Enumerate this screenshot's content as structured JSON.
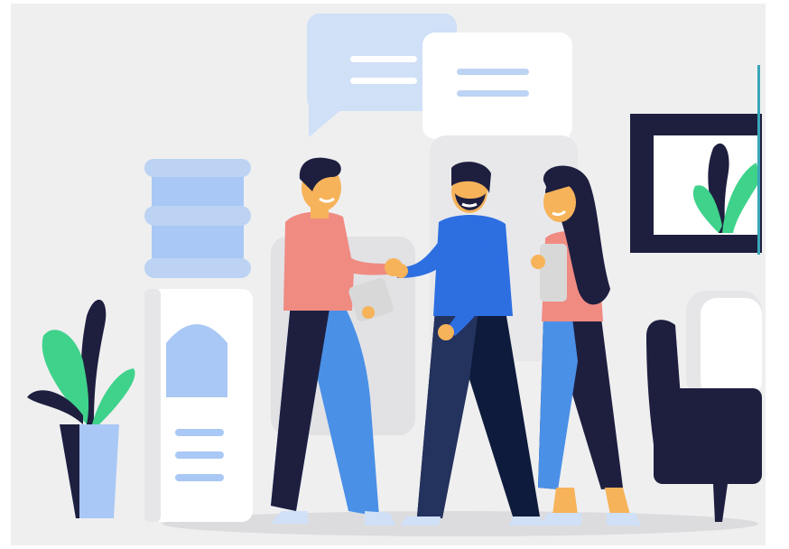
{
  "illustration": {
    "subject": "office-greeting-scene",
    "elements": [
      "speech-bubble",
      "speech-bubble",
      "water-cooler",
      "potted-plant",
      "man-pink-shirt",
      "man-blue-sweater",
      "woman-long-hair",
      "wall-picture",
      "armchair"
    ]
  },
  "colors": {
    "background_panel": "#efeff0",
    "bubble_back": "#cfe0f7",
    "bubble_front": "#ffffff",
    "bubble_lines": "#bcd3f3",
    "navy": "#1e1f3f",
    "blue_bright": "#2d6fe1",
    "blue_light": "#a9c8f5",
    "blue_pants": "#4a90e7",
    "pink": "#f08b82",
    "skin": "#f6b35a",
    "green": "#3fd28b",
    "gray_tablet": "#d8d8d8",
    "shadow": "#dcdcdf"
  }
}
